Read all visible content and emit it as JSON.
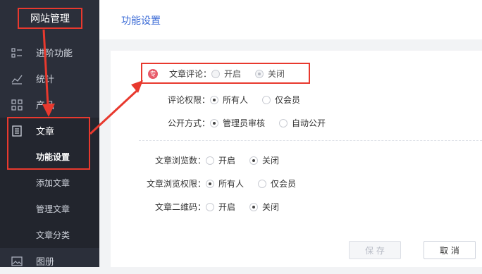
{
  "brand": {
    "title": "网站管理"
  },
  "sidebar": {
    "items": [
      {
        "label": "进阶功能",
        "icon": "list-icon"
      },
      {
        "label": "统计",
        "icon": "chart-icon"
      },
      {
        "label": "产品",
        "icon": "grid-icon"
      },
      {
        "label": "文章",
        "icon": "document-icon"
      },
      {
        "label": "功能设置"
      },
      {
        "label": "添加文章"
      },
      {
        "label": "管理文章"
      },
      {
        "label": "文章分类"
      },
      {
        "label": "图册",
        "icon": "image-icon"
      }
    ]
  },
  "header": {
    "title": "功能设置"
  },
  "form": {
    "comment": {
      "badge": "专",
      "label": "文章评论：",
      "options": [
        "开启",
        "关闭"
      ],
      "selected": 1
    },
    "comment_perm": {
      "label": "评论权限：",
      "options": [
        "所有人",
        "仅会员"
      ],
      "selected": 0
    },
    "publish_mode": {
      "label": "公开方式：",
      "options": [
        "管理员审核",
        "自动公开"
      ],
      "selected": 0
    },
    "view_count": {
      "label": "文章浏览数：",
      "options": [
        "开启",
        "关闭"
      ],
      "selected": 1
    },
    "view_perm": {
      "label": "文章浏览权限：",
      "options": [
        "所有人",
        "仅会员"
      ],
      "selected": 0
    },
    "qrcode": {
      "label": "文章二维码：",
      "options": [
        "开启",
        "关闭"
      ],
      "selected": 1
    }
  },
  "buttons": {
    "save": "保 存",
    "cancel": "取 消"
  },
  "colors": {
    "accent": "#3b6bd6",
    "highlight": "#e8392e",
    "sidebar": "#2b2f3a"
  }
}
